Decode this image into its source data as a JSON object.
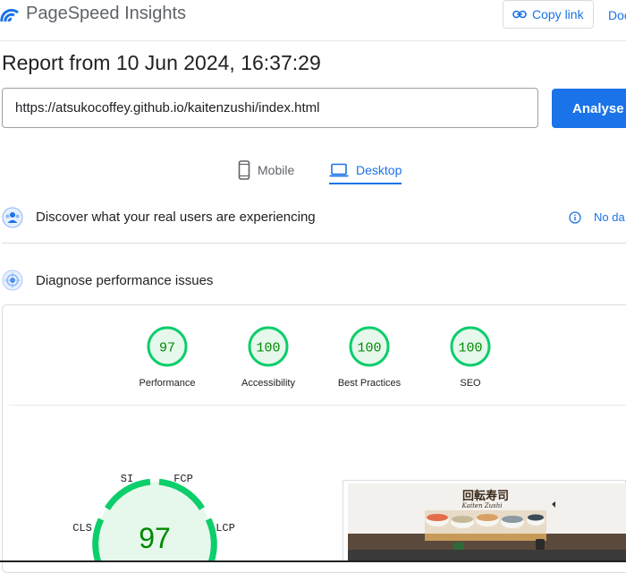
{
  "header": {
    "title": "PageSpeed Insights",
    "copy_link": "Copy link",
    "docs": "Doc"
  },
  "report": {
    "title": "Report from 10 Jun 2024, 16:37:29"
  },
  "url_input": {
    "value": "https://atsukocoffey.github.io/kaitenzushi/index.html"
  },
  "analyse_button": "Analyse",
  "tabs": [
    {
      "label": "Mobile",
      "active": false
    },
    {
      "label": "Desktop",
      "active": true
    }
  ],
  "field_section": {
    "title": "Discover what your real users are experiencing",
    "no_data": "No da"
  },
  "lab_section": {
    "title": "Diagnose performance issues"
  },
  "scores": [
    {
      "label": "Performance",
      "value": "97"
    },
    {
      "label": "Accessibility",
      "value": "100"
    },
    {
      "label": "Best Practices",
      "value": "100"
    },
    {
      "label": "SEO",
      "value": "100"
    }
  ],
  "big_gauge": {
    "value": "97",
    "metrics": [
      "SI",
      "FCP",
      "CLS",
      "LCP"
    ]
  },
  "screenshot": {
    "logo_text": "回転寿司",
    "subtitle": "Kaiten Zushi"
  },
  "colors": {
    "accent": "#1a73e8",
    "pass": "#0cce6b",
    "pass_text": "#008800",
    "pass_fill": "#e6f8ec"
  }
}
